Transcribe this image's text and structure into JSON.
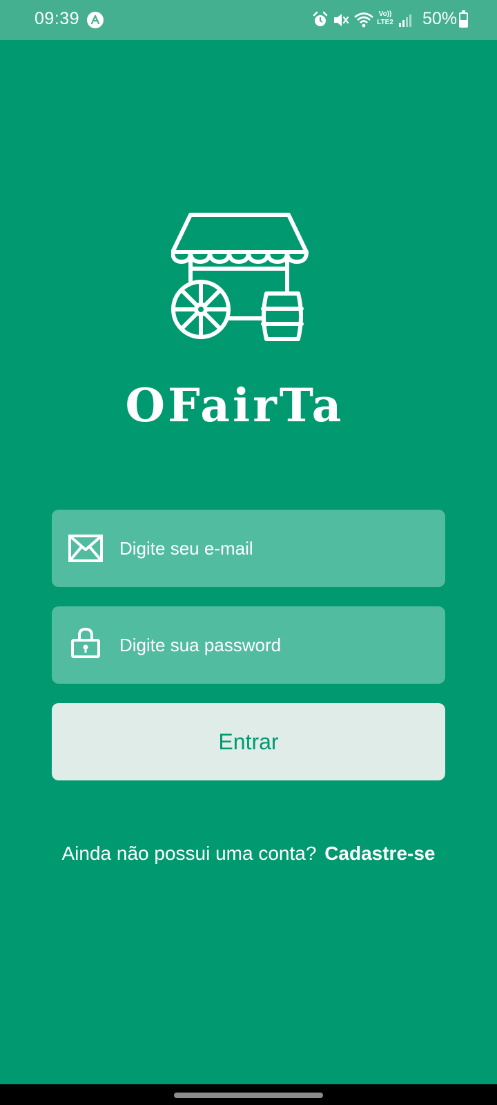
{
  "status_bar": {
    "time": "09:39",
    "battery": "50%",
    "network_label": "Vo)) LTE2",
    "icons": [
      "app-notification-icon",
      "alarm-icon",
      "mute-icon",
      "wifi-icon",
      "signal-icon",
      "battery-icon"
    ]
  },
  "brand": {
    "name": "OFairTa",
    "logo_icon": "market-cart-icon"
  },
  "login": {
    "email_placeholder": "Digite seu e-mail",
    "password_placeholder": "Digite sua password",
    "email_icon": "envelope-icon",
    "password_icon": "lock-icon",
    "submit_label": "Entrar"
  },
  "signup": {
    "prompt": "Ainda não possui uma conta?",
    "link_label": "Cadastre-se"
  },
  "colors": {
    "background": "#009970",
    "status_bar": "#45b08f",
    "input_background": "#52bca0",
    "button_background": "#dfece7",
    "button_text": "#009970"
  }
}
